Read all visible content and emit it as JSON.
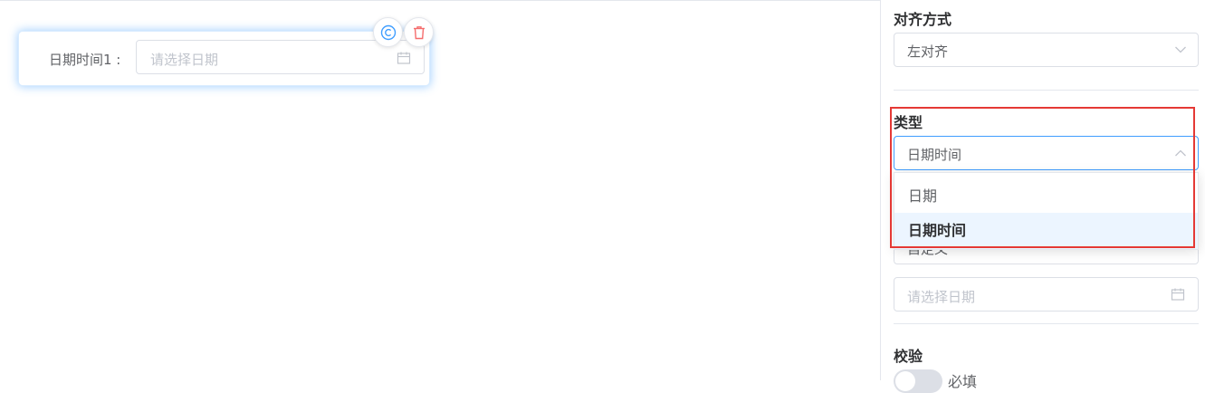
{
  "canvas": {
    "field": {
      "label": "日期时间1 :",
      "placeholder": "请选择日期"
    },
    "actions": {
      "copy_icon": "copyright-circle-icon",
      "delete_icon": "trash-icon"
    }
  },
  "panel": {
    "align": {
      "title": "对齐方式",
      "value": "左对齐"
    },
    "type": {
      "title": "类型",
      "value": "日期时间",
      "options": [
        "日期",
        "日期时间"
      ],
      "selected": "日期时间"
    },
    "default_mode": {
      "value": "自定义"
    },
    "default_value": {
      "placeholder": "请选择日期"
    },
    "validation": {
      "title": "校验",
      "required_label": "必填",
      "required_on": false
    }
  },
  "colors": {
    "accent": "#409eff",
    "highlight_border": "#e53935",
    "delete": "#f56c6c"
  }
}
